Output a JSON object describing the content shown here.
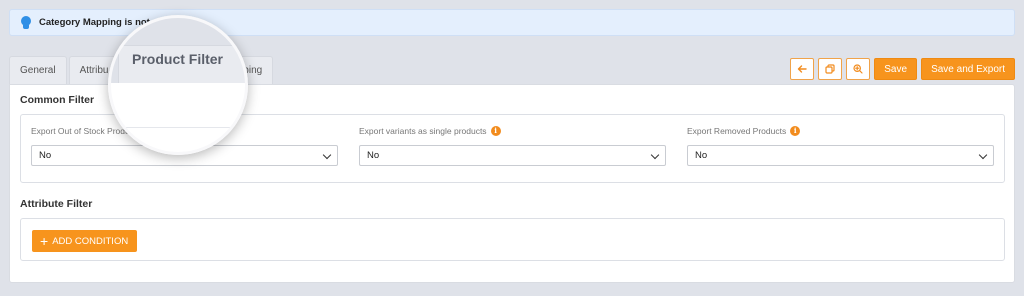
{
  "notice": {
    "text": "Category Mapping is not com"
  },
  "tabs": [
    {
      "label": "General"
    },
    {
      "label": "Attribu"
    },
    {
      "label": "Category Mapping"
    }
  ],
  "magnifier": {
    "label": "Product Filter"
  },
  "toolbar": {
    "back_icon": "arrow-left-icon",
    "copy_icon": "copy-icon",
    "preview_icon": "zoom-in-icon",
    "save_label": "Save",
    "save_export_label": "Save and Export"
  },
  "common_filter": {
    "title": "Common Filter",
    "fields": [
      {
        "label": "Export Out of Stock Produ",
        "value": "No",
        "info": false
      },
      {
        "label": "Export variants as single products",
        "value": "No",
        "info": true
      },
      {
        "label": "Export Removed Products",
        "value": "No",
        "info": true
      }
    ]
  },
  "attribute_filter": {
    "title": "Attribute Filter",
    "add_label": "ADD CONDITION"
  },
  "colors": {
    "accent": "#f7941d",
    "info_blue": "#2f8fe6",
    "notice_bg": "#e4effd"
  }
}
